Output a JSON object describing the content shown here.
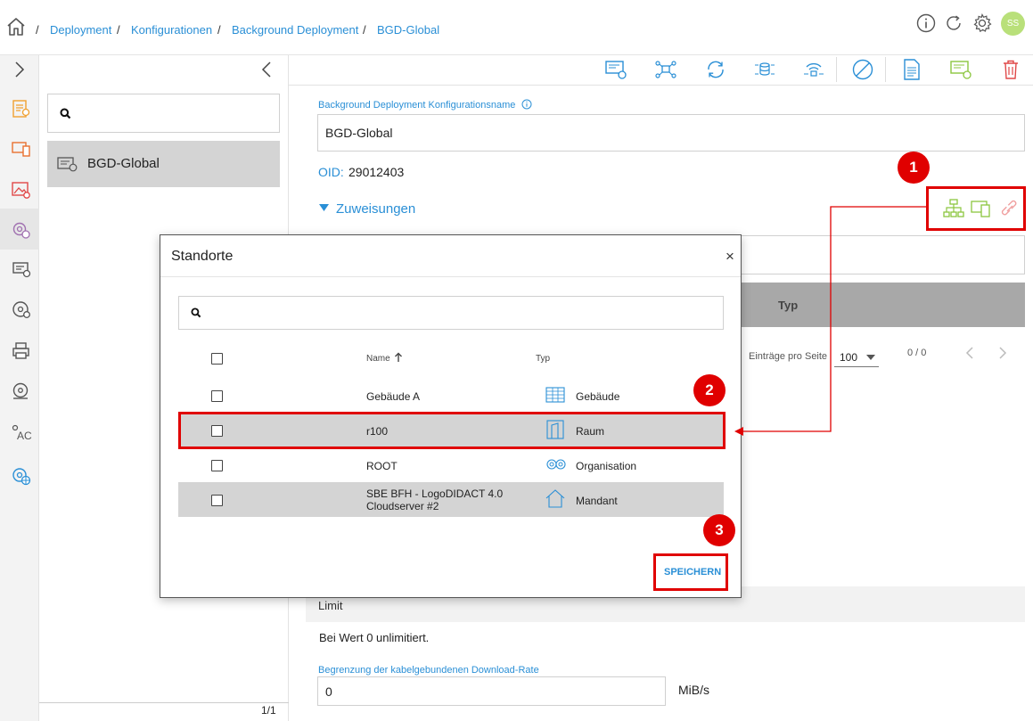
{
  "breadcrumb": {
    "items": [
      "Deployment",
      "Konfigurationen",
      "Background Deployment",
      "BGD-Global"
    ],
    "separator": "/"
  },
  "header": {
    "avatar_initials": "SS"
  },
  "list_panel": {
    "item_label": "BGD-Global",
    "pager": "1/1"
  },
  "form": {
    "name_label": "Background Deployment Konfigurationsname",
    "name_value": "BGD-Global",
    "oid_label": "OID:",
    "oid_value": "29012403",
    "assignments_label": "Zuweisungen",
    "table_type_header": "Typ",
    "entries_per_page_label": "Einträge pro Seite",
    "entries_per_page_value": "100",
    "page_count": "0 / 0",
    "limit_header": "Limit",
    "unlimited_note": "Bei Wert 0 unlimitiert.",
    "download_rate_label": "Begrenzung der kabelgebundenen Download-Rate",
    "download_rate_value": "0",
    "download_rate_unit": "MiB/s"
  },
  "modal": {
    "title": "Standorte",
    "close": "×",
    "col_name": "Name",
    "col_type": "Typ",
    "rows": [
      {
        "name": "Gebäude A",
        "name2": "",
        "type": "Gebäude"
      },
      {
        "name": "r100",
        "name2": "",
        "type": "Raum"
      },
      {
        "name": "ROOT",
        "name2": "",
        "type": "Organisation"
      },
      {
        "name": "SBE BFH - LogoDIDACT 4.0",
        "name2": "Cloudserver #2",
        "type": "Mandant"
      }
    ],
    "save_label": "SPEICHERN"
  },
  "annotations": {
    "badge1": "1",
    "badge2": "2",
    "badge3": "3"
  },
  "colors": {
    "accent": "#2a8fd6",
    "highlight_red": "#e00000",
    "icon_green": "#8cc63f",
    "row_selected": "#d4d4d4"
  }
}
